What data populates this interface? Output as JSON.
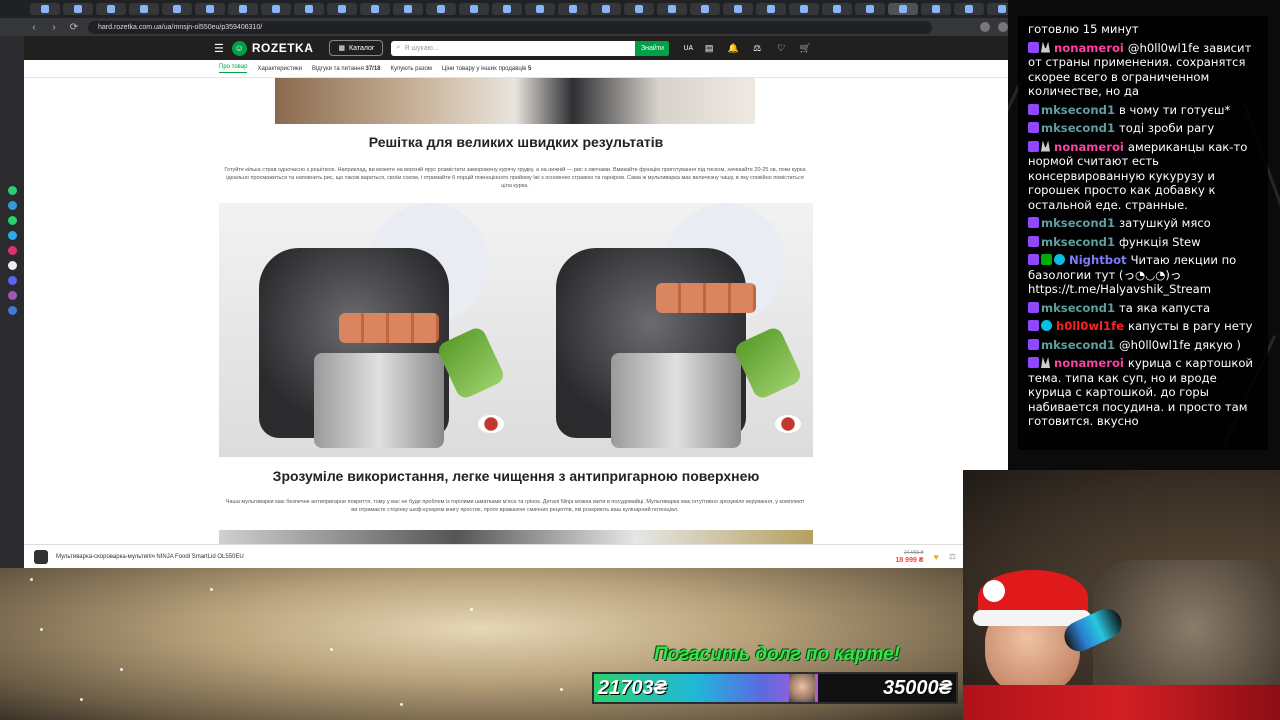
{
  "browser": {
    "url": "hard.rozetka.com.ua/ua/mnsjn-ol550eu/p359406310/",
    "tabs_count": 40
  },
  "header": {
    "logo_text": "ROZETKA",
    "catalog_label": "Каталог",
    "search_placeholder": "Я шукаю...",
    "search_button": "Знайти",
    "lang": "UA"
  },
  "subnav": {
    "items": [
      "Про товар",
      "Характеристики",
      "Відгуки та питання",
      "Купують разом",
      "Ціни товару у інших продавців"
    ],
    "reviews_count": "37/18",
    "sellers_count": "5"
  },
  "article": {
    "heading1": "Решітка для великих швидких результатів",
    "para1": "Готуйте кілька страв одночасно з решіткою. Наприклад, ви можете на верхній ярус розмістити заморожену курячу грудку, а на нижній — рис з овочами. Вмикайте функцію приготування під тиском, зачекайте 20-25 хв, поки курка ідеально просмажиться та наповнить рис, що також вариться, своїм соком, і отримайте 6 порцій повноцінного прийому їжі з основною стравою та гарніром. Сама ж мультиварка має величезну чашу, в яку спокійно поміститься ціла курка.",
    "heading2": "Зрозуміле використання, легке чищення з антипригарною поверхнею",
    "para2": "Чаша мультиварки має безпечне антипригарне покриття, тому у вас не буде проблем із горілими шматками м'яса та грінок. Деталі Ninja можна мити в посудомийці. Мультиварка має інтуїтивно зрозуміле керування, у комплекті ви отримаєте сторінку шеф-кухарем книгу простих, проте вражаюче смачних рецептів, які розкриють ваш кулінарний потенціал."
  },
  "sticky": {
    "title": "Мультиварка-скороварка-мультипіч NINJA Foodi SmartLid OL550EU",
    "old_price": "24 999 ₴",
    "new_price": "18 999 ₴"
  },
  "donation": {
    "title": "Погасить долг по карте!",
    "current": "21703₴",
    "goal": "35000₴",
    "progress": 0.62
  },
  "chat": {
    "messages": [
      {
        "user": "",
        "text": "готовлю 15 минут",
        "color": "#ffffff",
        "badges": []
      },
      {
        "user": "nonameroi",
        "text": "@h0ll0wl1fe зависит от страны применения. сохранятся скорее всего в ограниченном количестве, но да",
        "color": "#ff3fa4",
        "badges": [
          "sub",
          "bits"
        ]
      },
      {
        "user": "mksecond1",
        "text": "в чому ти готуєш*",
        "color": "#5f9ea0",
        "badges": [
          "sub"
        ]
      },
      {
        "user": "mksecond1",
        "text": "тоді зроби рагу",
        "color": "#5f9ea0",
        "badges": [
          "sub"
        ]
      },
      {
        "user": "nonameroi",
        "text": "американцы как-то нормой считают есть консервированную кукурузу и горошек просто как добавку к остальной еде. странные.",
        "color": "#ff3fa4",
        "badges": [
          "sub",
          "bits"
        ]
      },
      {
        "user": "mksecond1",
        "text": "затушкуй мясо",
        "color": "#5f9ea0",
        "badges": [
          "sub"
        ]
      },
      {
        "user": "mksecond1",
        "text": "функція Stew",
        "color": "#5f9ea0",
        "badges": [
          "sub"
        ]
      },
      {
        "user": "Nightbot",
        "text": "Читаю лекции по базологии тут (っ◔◡◔)っ https://t.me/Halyavshik_Stream",
        "color": "#7c7cff",
        "badges": [
          "sub",
          "green",
          "cyan"
        ]
      },
      {
        "user": "mksecond1",
        "text": "та яка капуста",
        "color": "#5f9ea0",
        "badges": [
          "sub"
        ]
      },
      {
        "user": "h0ll0wl1fe",
        "text": "капусты в рагу нету",
        "color": "#ff2020",
        "badges": [
          "sub",
          "cyan"
        ]
      },
      {
        "user": "mksecond1",
        "text": "@h0ll0wl1fe дякую )",
        "color": "#5f9ea0",
        "badges": [
          "sub"
        ]
      },
      {
        "user": "nonameroi",
        "text": "курица с картошкой тема. типа как суп, но и вроде курица с картошкой. до горы набивается посудина. и просто там готовится. вкусно",
        "color": "#ff3fa4",
        "badges": [
          "sub",
          "bits"
        ]
      }
    ]
  }
}
